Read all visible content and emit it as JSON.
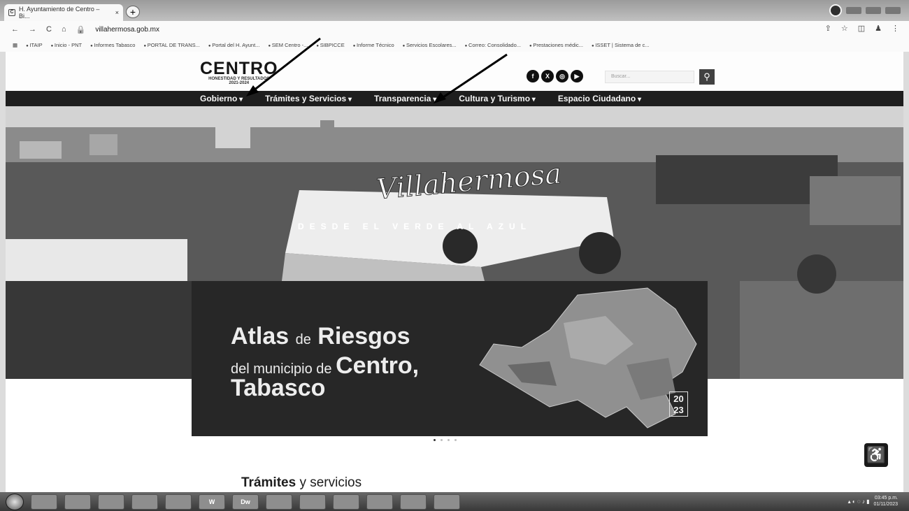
{
  "browser": {
    "tab_title": "H. Ayuntamiento de Centro – Bi...",
    "tab_close": "×",
    "newtab": "+",
    "url": "villahermosa.gob.mx",
    "nav_back": "←",
    "nav_forward": "→",
    "nav_reload": "C",
    "nav_home": "⌂"
  },
  "bookmarks": [
    "ITAIP",
    "Inicio - PNT",
    "Informes Tabasco",
    "PORTAL DE TRANS...",
    "Portal del H. Ayunt...",
    "SEM Centro -...",
    "SIBPICCE",
    "Informe Técnico",
    "Servicios Escolares...",
    "Correo: Consolidado...",
    "Prestaciones médic...",
    "ISSET | Sistema de c..."
  ],
  "site": {
    "logo_text": "CENTRO",
    "logo_sub": "HONESTIDAD Y RESULTADOS",
    "logo_years": "2021-2024",
    "search_placeholder": "Buscar...",
    "nav": [
      "Gobierno",
      "Trámites y Servicios",
      "Transparencia",
      "Cultura y Turismo",
      "Espacio Ciudadano"
    ],
    "hero_script": "Villahermosa",
    "hero_tagline": "DESDE EL VERDE AL AZUL",
    "banner": {
      "w1": "Atlas",
      "w2": "de",
      "w3": "Riesgos",
      "w4": "del municipio de",
      "w5": "Centro,",
      "w6": "Tabasco",
      "year_top": "20",
      "year_bottom": "23"
    },
    "section_title_bold": "Trámites",
    "section_title_rest": "y servicios"
  },
  "taskbar": {
    "apps": [
      "",
      "",
      "",
      "",
      "",
      "",
      "W",
      "Dw",
      "",
      "",
      "",
      "",
      "",
      ""
    ],
    "clock_time": "03:45 p.m.",
    "clock_date": "01/11/2023"
  }
}
